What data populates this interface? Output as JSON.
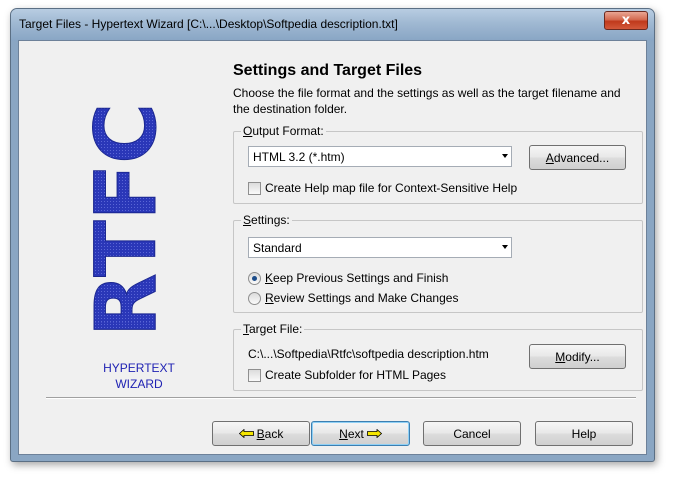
{
  "window": {
    "title": "Target Files - Hypertext Wizard [C:\\...\\Desktop\\Softpedia description.txt]",
    "close_label": "x"
  },
  "logo": {
    "text": "RTFC",
    "label_line1": "HYPERTEXT",
    "label_line2": "WIZARD",
    "color": "#2a37b8"
  },
  "page": {
    "heading": "Settings and Target Files",
    "description": "Choose the file format and the settings as well as the target filename and the destination folder."
  },
  "output_format": {
    "legend_first": "O",
    "legend_rest": "utput Format:",
    "selected": "HTML 3.2 (*.htm)",
    "advanced_first": "A",
    "advanced_rest": "dvanced...",
    "help_map_label": "Create Help map file for Context-Sensitive Help"
  },
  "settings": {
    "legend_first": "S",
    "legend_rest": "ettings:",
    "selected": "Standard",
    "keep_first": "K",
    "keep_rest": "eep Previous Settings and Finish",
    "review_first": "R",
    "review_rest": "eview Settings and Make Changes"
  },
  "target_file": {
    "legend_first": "T",
    "legend_rest": "arget File:",
    "path": "C:\\...\\Softpedia\\Rtfc\\softpedia description.htm",
    "modify_first": "M",
    "modify_rest": "odify...",
    "subfolder_label": "Create Subfolder for HTML Pages"
  },
  "buttons": {
    "back_first": "B",
    "back_rest": "ack",
    "next_first": "N",
    "next_rest": "ext",
    "cancel": "Cancel",
    "help": "Help"
  }
}
